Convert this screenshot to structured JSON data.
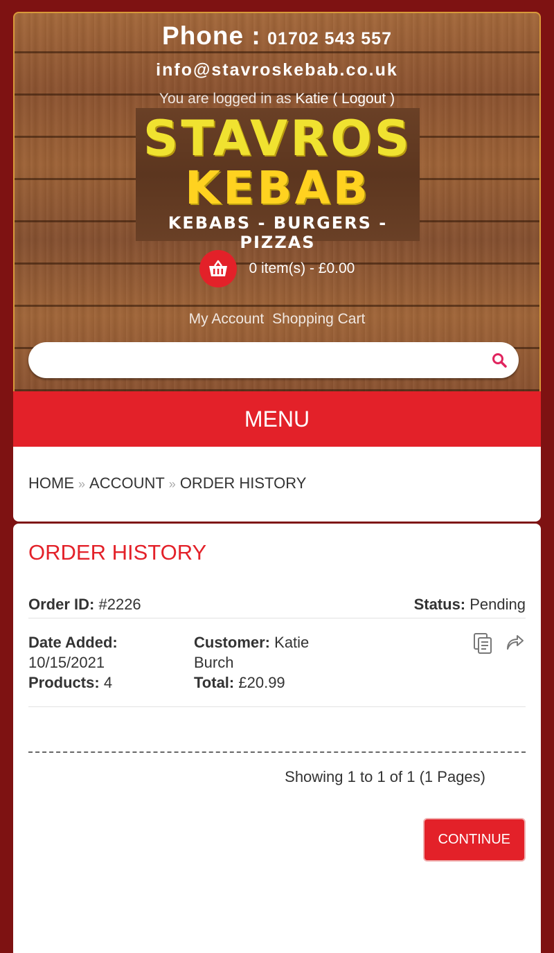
{
  "header": {
    "phone_label": "Phone :",
    "phone_number": "01702 543 557",
    "email": "info@stavroskebab.co.uk",
    "login_prefix": "You are logged in as",
    "login_user": "Katie",
    "logout": "( Logout )"
  },
  "logo": {
    "line1": "STAVROS",
    "line2": "KEBAB",
    "tagline": "KEBABS - BURGERS -PIZZAS"
  },
  "cart": {
    "summary": "0 item(s) - £0.00"
  },
  "links": {
    "account": "My Account",
    "cart": "Shopping Cart"
  },
  "search": {
    "placeholder": ""
  },
  "menu": {
    "label": "MENU"
  },
  "breadcrumb": [
    "HOME",
    "ACCOUNT",
    "ORDER HISTORY"
  ],
  "breadcrumb_sep": "»",
  "content": {
    "title": "ORDER HISTORY",
    "order": {
      "id_label": "Order ID:",
      "id": "#2226",
      "status_label": "Status:",
      "status": "Pending",
      "date_label": "Date Added:",
      "date": "10/15/2021",
      "products_label": "Products:",
      "products": "4",
      "customer_label": "Customer:",
      "customer": "Katie Burch",
      "total_label": "Total:",
      "total": "£20.99"
    },
    "pagination": "Showing 1 to 1 of 1 (1 Pages)",
    "continue": "CONTINUE"
  },
  "colors": {
    "brand_red": "#e32129",
    "page_bg": "#7e1212"
  }
}
